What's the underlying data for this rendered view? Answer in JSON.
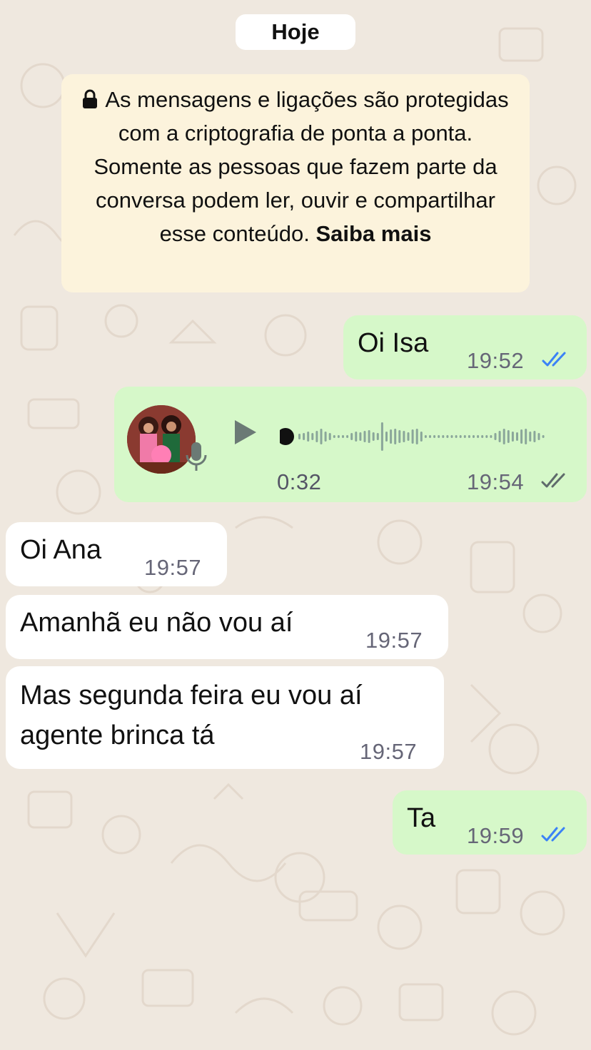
{
  "date_separator": "Hoje",
  "encryption_notice": {
    "text": "As mensagens e ligações são protegidas com a criptografia de ponta a ponta. Somente as pessoas que fazem parte da conversa podem ler, ouvir e compartilhar esse conteúdo.",
    "link": "Saiba mais"
  },
  "messages": [
    {
      "direction": "outgoing",
      "text": "Oi Isa",
      "time": "19:52",
      "status": "read"
    },
    {
      "direction": "outgoing",
      "type": "voice",
      "duration": "0:32",
      "time": "19:54",
      "status": "delivered",
      "progress": 0
    },
    {
      "direction": "incoming",
      "text": "Oi Ana",
      "time": "19:57"
    },
    {
      "direction": "incoming",
      "text": "Amanhã eu não vou aí",
      "time": "19:57"
    },
    {
      "direction": "incoming",
      "text_line1": "Mas segunda feira eu vou aí",
      "text_line2": "agente brinca tá",
      "time": "19:57"
    },
    {
      "direction": "outgoing",
      "text": "Ta",
      "time": "19:59",
      "status": "read"
    }
  ],
  "colors": {
    "wallpaper": "#efe8df",
    "outgoing_bubble": "#d6f8c9",
    "incoming_bubble": "#ffffff",
    "notice_bg": "#fcf3dc",
    "read_tick": "#3b82f6",
    "delivered_tick": "#5f6b6b"
  }
}
